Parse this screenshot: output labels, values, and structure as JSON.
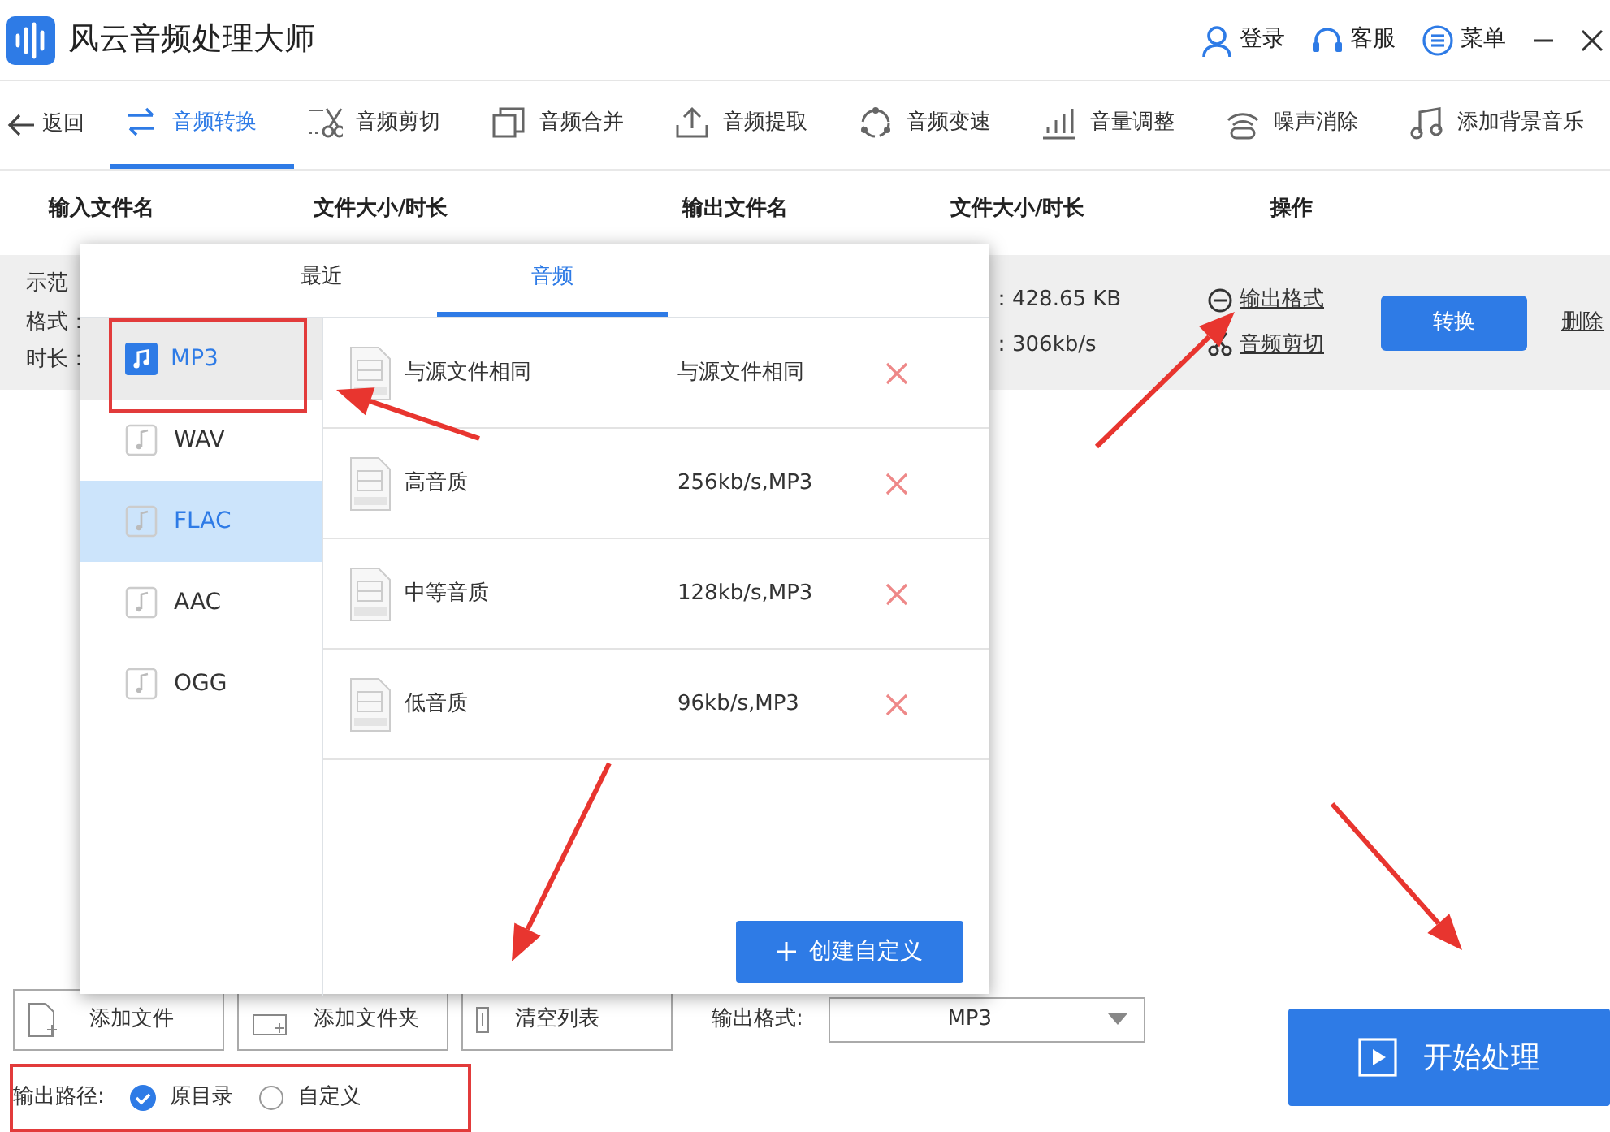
{
  "app": {
    "title": "风云音频处理大师"
  },
  "header_links": [
    {
      "label": "登录"
    },
    {
      "label": "客服"
    },
    {
      "label": "菜单"
    }
  ],
  "toolbar": {
    "back": "返回",
    "tools": [
      {
        "label": "音频转换",
        "selected": true
      },
      {
        "label": "音频剪切",
        "selected": false
      },
      {
        "label": "音频合并",
        "selected": false
      },
      {
        "label": "音频提取",
        "selected": false
      },
      {
        "label": "音频变速",
        "selected": false
      },
      {
        "label": "音量调整",
        "selected": false
      },
      {
        "label": "噪声消除",
        "selected": false
      },
      {
        "label": "添加背景音乐",
        "selected": false
      }
    ]
  },
  "table": {
    "columns": [
      "输入文件名",
      "文件大小/时长",
      "输出文件名",
      "文件大小/时长",
      "操作"
    ],
    "rows": [
      {
        "name": "示范",
        "format_label": "格式：",
        "duration_label": "时长：",
        "size": "：428.65 KB",
        "bitrate": "：306kb/s",
        "links": [
          "输出格式",
          "音频剪切"
        ],
        "convert": "转换",
        "delete": "删除"
      }
    ]
  },
  "dialog": {
    "tabs": [
      {
        "label": "最近",
        "selected": false
      },
      {
        "label": "音频",
        "selected": true
      }
    ],
    "formats": [
      {
        "label": "MP3",
        "selected": true,
        "hovered": false
      },
      {
        "label": "WAV",
        "selected": false,
        "hovered": false
      },
      {
        "label": "FLAC",
        "selected": false,
        "hovered": true
      },
      {
        "label": "AAC",
        "selected": false,
        "hovered": false
      },
      {
        "label": "OGG",
        "selected": false,
        "hovered": false
      }
    ],
    "presets": [
      {
        "name": "与源文件相同",
        "spec": "与源文件相同"
      },
      {
        "name": "高音质",
        "spec": "256kb/s,MP3"
      },
      {
        "name": "中等音质",
        "spec": "128kb/s,MP3"
      },
      {
        "name": "低音质",
        "spec": "96kb/s,MP3"
      }
    ],
    "create_button": "创建自定义"
  },
  "bottom": {
    "buttons": [
      "添加文件",
      "添加文件夹",
      "清空列表"
    ],
    "format_label": "输出格式:",
    "format_value": "MP3",
    "path_label": "输出路径:",
    "path_options": [
      {
        "label": "原目录",
        "selected": true
      },
      {
        "label": "自定义",
        "selected": false
      }
    ],
    "start_button": "开始处理"
  }
}
